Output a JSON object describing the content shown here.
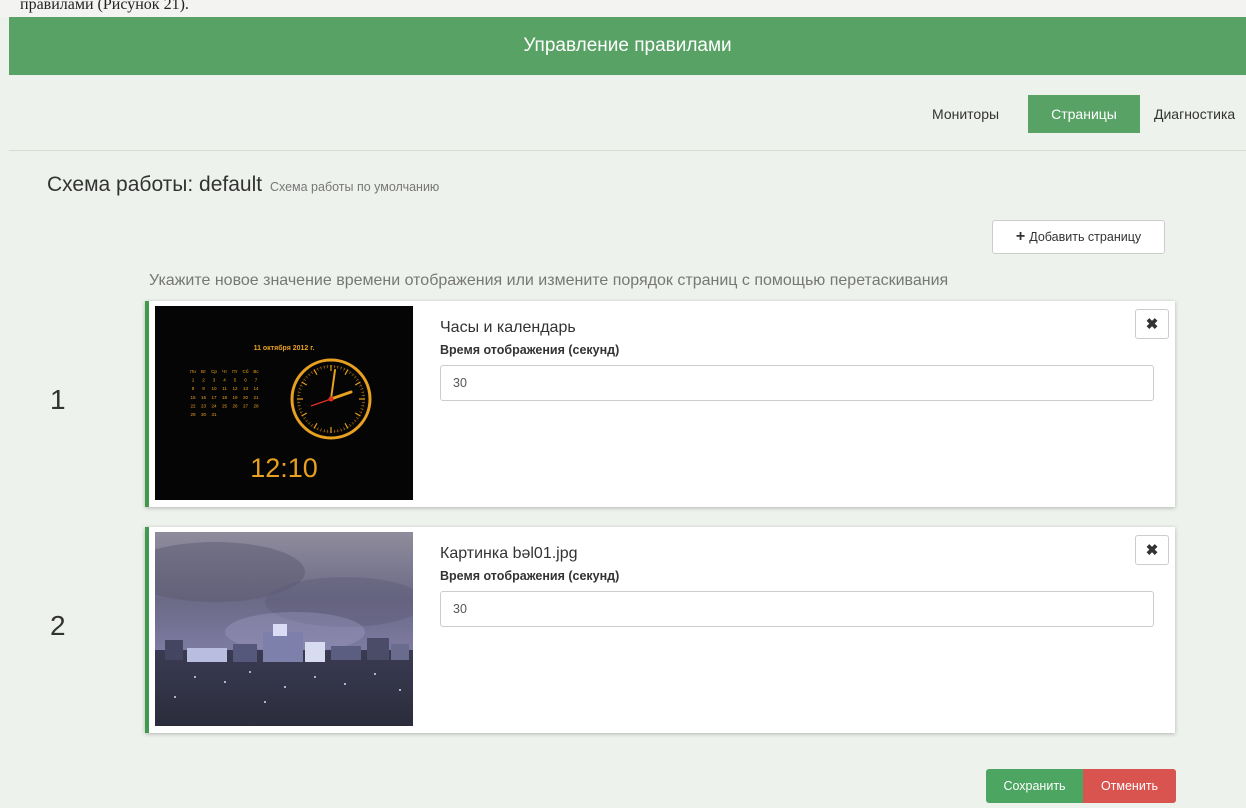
{
  "header": {
    "title": "Управление правилами"
  },
  "top_strip": {
    "text": "правилами (Рисунок 21)."
  },
  "nav": {
    "items": [
      {
        "label": "Мониторы",
        "active": false
      },
      {
        "label": "Страницы",
        "active": true
      },
      {
        "label": "Диагностика",
        "active": false
      }
    ]
  },
  "scheme": {
    "title": "Схема работы: default",
    "description": "Схема работы по умолчанию"
  },
  "add_page_label": "Добавить страницу",
  "hint": "Укажите новое значение времени отображения или измените порядок страниц с помощью перетаскивания",
  "pages": [
    {
      "number": "1",
      "title": "Часы и календарь",
      "time_label": "Время отображения (секунд)",
      "time_value": "30",
      "remove_icon": "close-icon",
      "thumb": {
        "kind": "clock",
        "date_text": "11 октября 2012 г.",
        "weekdays": [
          "Пн",
          "Вт",
          "Ср",
          "Чт",
          "Пт",
          "Сб",
          "Вс"
        ],
        "calendar_rows": [
          [
            "1",
            "2",
            "3",
            "4",
            "5",
            "6",
            "7"
          ],
          [
            "8",
            "9",
            "10",
            "11",
            "12",
            "13",
            "14"
          ],
          [
            "15",
            "16",
            "17",
            "18",
            "19",
            "20",
            "21"
          ],
          [
            "22",
            "23",
            "24",
            "25",
            "26",
            "27",
            "28"
          ],
          [
            "29",
            "30",
            "31",
            "",
            "",
            "",
            ""
          ]
        ],
        "time_text": "12:10"
      }
    },
    {
      "number": "2",
      "title": "Картинка bəl01.jpg",
      "time_label": "Время отображения (секунд)",
      "time_value": "30",
      "remove_icon": "close-icon",
      "thumb": {
        "kind": "photo"
      }
    }
  ],
  "footer": {
    "save_label": "Сохранить",
    "cancel_label": "Отменить"
  },
  "colors": {
    "brand_green": "#57a264",
    "card_accent": "#3f9a4d",
    "danger": "#d9534f",
    "clock_orange": "#e8a020"
  }
}
